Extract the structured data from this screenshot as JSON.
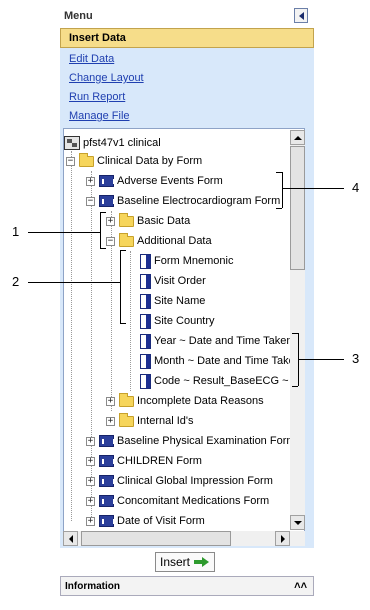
{
  "menu": {
    "title": "Menu",
    "active": "Insert Data",
    "links": [
      "Edit Data",
      "Change Layout",
      "Run Report",
      "Manage File"
    ]
  },
  "tree": {
    "root": "pfst47v1 clinical",
    "rows": [
      {
        "label": "Clinical Data by Form"
      },
      {
        "label": "Adverse Events Form"
      },
      {
        "label": "Baseline Electrocardiogram Form"
      },
      {
        "label": "Basic Data"
      },
      {
        "label": "Additional Data"
      },
      {
        "label": "Form Mnemonic"
      },
      {
        "label": "Visit Order"
      },
      {
        "label": "Site Name"
      },
      {
        "label": "Site Country"
      },
      {
        "label": "Year ~ Date and Time Taken"
      },
      {
        "label": "Month ~ Date and Time Taken"
      },
      {
        "label": "Code ~ Result_BaseECG ~ Code"
      },
      {
        "label": "Incomplete Data Reasons"
      },
      {
        "label": "Internal Id's"
      },
      {
        "label": "Baseline Physical Examination Form"
      },
      {
        "label": "CHILDREN Form"
      },
      {
        "label": "Clinical Global Impression Form"
      },
      {
        "label": "Concomitant Medications Form"
      },
      {
        "label": "Date of Visit Form"
      }
    ]
  },
  "insert_button": "Insert",
  "info_bar": "Information",
  "callouts": [
    "1",
    "2",
    "3",
    "4"
  ],
  "colors": {
    "active_bg": "#f6dd8a",
    "menu_bg": "#d8e8fa",
    "link": "#1f3fb0"
  }
}
